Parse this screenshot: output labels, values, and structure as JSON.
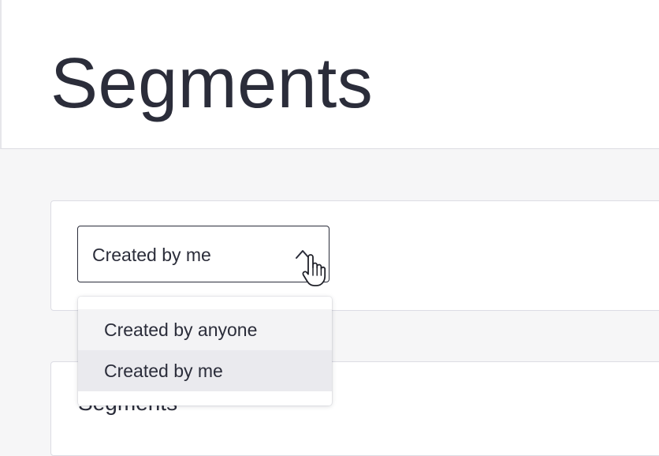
{
  "header": {
    "title": "Segments"
  },
  "filter": {
    "selected_label": "Created by me",
    "options": [
      {
        "label": "Created by anyone"
      },
      {
        "label": "Created by me"
      }
    ]
  },
  "segments_section": {
    "heading": "Segments"
  },
  "icons": {
    "select_chevron": "chevron-up-icon",
    "cursor": "hand-pointer-cursor"
  },
  "colors": {
    "text": "#2b2d3a",
    "page_background": "#f6f6f7",
    "option_hover": "#f3f3f5",
    "option_selected": "#eaeaee"
  }
}
